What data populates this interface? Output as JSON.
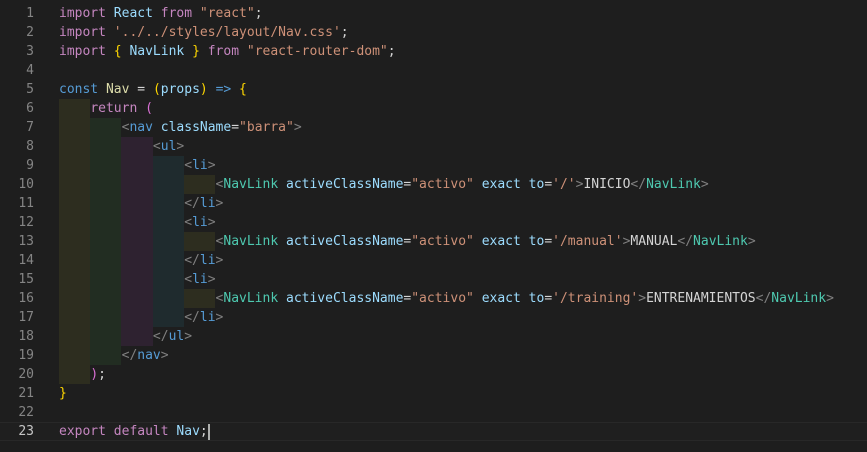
{
  "editor": {
    "lines": [
      {
        "n": "1",
        "tokens": [
          {
            "t": "import",
            "c": "#c586c0"
          },
          {
            "t": " React ",
            "c": "#9cdcfe"
          },
          {
            "t": "from",
            "c": "#c586c0"
          },
          {
            "t": " ",
            "c": "#d4d4d4"
          },
          {
            "t": "\"react\"",
            "c": "#ce9178"
          },
          {
            "t": ";",
            "c": "#d4d4d4"
          }
        ]
      },
      {
        "n": "2",
        "tokens": [
          {
            "t": "import",
            "c": "#c586c0"
          },
          {
            "t": " ",
            "c": "#d4d4d4"
          },
          {
            "t": "'../../styles/layout/Nav.css'",
            "c": "#ce9178"
          },
          {
            "t": ";",
            "c": "#d4d4d4"
          }
        ]
      },
      {
        "n": "3",
        "tokens": [
          {
            "t": "import",
            "c": "#c586c0"
          },
          {
            "t": " ",
            "c": "#d4d4d4"
          },
          {
            "t": "{",
            "c": "#ffd700"
          },
          {
            "t": " NavLink ",
            "c": "#9cdcfe"
          },
          {
            "t": "}",
            "c": "#ffd700"
          },
          {
            "t": " ",
            "c": "#d4d4d4"
          },
          {
            "t": "from",
            "c": "#c586c0"
          },
          {
            "t": " ",
            "c": "#d4d4d4"
          },
          {
            "t": "\"react-router-dom\"",
            "c": "#ce9178"
          },
          {
            "t": ";",
            "c": "#d4d4d4"
          }
        ]
      },
      {
        "n": "4",
        "tokens": []
      },
      {
        "n": "5",
        "tokens": [
          {
            "t": "const",
            "c": "#569cd6"
          },
          {
            "t": " ",
            "c": "#d4d4d4"
          },
          {
            "t": "Nav",
            "c": "#dcdcaa"
          },
          {
            "t": " = ",
            "c": "#d4d4d4"
          },
          {
            "t": "(",
            "c": "#ffd700"
          },
          {
            "t": "props",
            "c": "#9cdcfe"
          },
          {
            "t": ")",
            "c": "#ffd700"
          },
          {
            "t": " ",
            "c": "#d4d4d4"
          },
          {
            "t": "=>",
            "c": "#569cd6"
          },
          {
            "t": " ",
            "c": "#d4d4d4"
          },
          {
            "t": "{",
            "c": "#ffd700"
          }
        ]
      },
      {
        "n": "6",
        "tokens": [
          {
            "t": "    ",
            "c": "#d4d4d4"
          },
          {
            "t": "return",
            "c": "#c586c0"
          },
          {
            "t": " ",
            "c": "#d4d4d4"
          },
          {
            "t": "(",
            "c": "#da70d6"
          }
        ]
      },
      {
        "n": "7",
        "tokens": [
          {
            "t": "        ",
            "c": "#d4d4d4"
          },
          {
            "t": "<",
            "c": "#808080"
          },
          {
            "t": "nav",
            "c": "#569cd6"
          },
          {
            "t": " ",
            "c": "#d4d4d4"
          },
          {
            "t": "className",
            "c": "#9cdcfe"
          },
          {
            "t": "=",
            "c": "#d4d4d4"
          },
          {
            "t": "\"barra\"",
            "c": "#ce9178"
          },
          {
            "t": ">",
            "c": "#808080"
          }
        ]
      },
      {
        "n": "8",
        "tokens": [
          {
            "t": "            ",
            "c": "#d4d4d4"
          },
          {
            "t": "<",
            "c": "#808080"
          },
          {
            "t": "ul",
            "c": "#569cd6"
          },
          {
            "t": ">",
            "c": "#808080"
          }
        ]
      },
      {
        "n": "9",
        "tokens": [
          {
            "t": "                ",
            "c": "#d4d4d4"
          },
          {
            "t": "<",
            "c": "#808080"
          },
          {
            "t": "li",
            "c": "#569cd6"
          },
          {
            "t": ">",
            "c": "#808080"
          }
        ]
      },
      {
        "n": "10",
        "tokens": [
          {
            "t": "                    ",
            "c": "#d4d4d4"
          },
          {
            "t": "<",
            "c": "#808080"
          },
          {
            "t": "NavLink",
            "c": "#4ec9b0"
          },
          {
            "t": " ",
            "c": "#d4d4d4"
          },
          {
            "t": "activeClassName",
            "c": "#9cdcfe"
          },
          {
            "t": "=",
            "c": "#d4d4d4"
          },
          {
            "t": "\"activo\"",
            "c": "#ce9178"
          },
          {
            "t": " ",
            "c": "#d4d4d4"
          },
          {
            "t": "exact",
            "c": "#9cdcfe"
          },
          {
            "t": " ",
            "c": "#d4d4d4"
          },
          {
            "t": "to",
            "c": "#9cdcfe"
          },
          {
            "t": "=",
            "c": "#d4d4d4"
          },
          {
            "t": "'/'",
            "c": "#ce9178"
          },
          {
            "t": ">",
            "c": "#808080"
          },
          {
            "t": "INICIO",
            "c": "#d4d4d4"
          },
          {
            "t": "</",
            "c": "#808080"
          },
          {
            "t": "NavLink",
            "c": "#4ec9b0"
          },
          {
            "t": ">",
            "c": "#808080"
          }
        ]
      },
      {
        "n": "11",
        "tokens": [
          {
            "t": "                ",
            "c": "#d4d4d4"
          },
          {
            "t": "</",
            "c": "#808080"
          },
          {
            "t": "li",
            "c": "#569cd6"
          },
          {
            "t": ">",
            "c": "#808080"
          }
        ]
      },
      {
        "n": "12",
        "tokens": [
          {
            "t": "                ",
            "c": "#d4d4d4"
          },
          {
            "t": "<",
            "c": "#808080"
          },
          {
            "t": "li",
            "c": "#569cd6"
          },
          {
            "t": ">",
            "c": "#808080"
          }
        ]
      },
      {
        "n": "13",
        "tokens": [
          {
            "t": "                    ",
            "c": "#d4d4d4"
          },
          {
            "t": "<",
            "c": "#808080"
          },
          {
            "t": "NavLink",
            "c": "#4ec9b0"
          },
          {
            "t": " ",
            "c": "#d4d4d4"
          },
          {
            "t": "activeClassName",
            "c": "#9cdcfe"
          },
          {
            "t": "=",
            "c": "#d4d4d4"
          },
          {
            "t": "\"activo\"",
            "c": "#ce9178"
          },
          {
            "t": " ",
            "c": "#d4d4d4"
          },
          {
            "t": "exact",
            "c": "#9cdcfe"
          },
          {
            "t": " ",
            "c": "#d4d4d4"
          },
          {
            "t": "to",
            "c": "#9cdcfe"
          },
          {
            "t": "=",
            "c": "#d4d4d4"
          },
          {
            "t": "'/manual'",
            "c": "#ce9178"
          },
          {
            "t": ">",
            "c": "#808080"
          },
          {
            "t": "MANUAL",
            "c": "#d4d4d4"
          },
          {
            "t": "</",
            "c": "#808080"
          },
          {
            "t": "NavLink",
            "c": "#4ec9b0"
          },
          {
            "t": ">",
            "c": "#808080"
          }
        ]
      },
      {
        "n": "14",
        "tokens": [
          {
            "t": "                ",
            "c": "#d4d4d4"
          },
          {
            "t": "</",
            "c": "#808080"
          },
          {
            "t": "li",
            "c": "#569cd6"
          },
          {
            "t": ">",
            "c": "#808080"
          }
        ]
      },
      {
        "n": "15",
        "tokens": [
          {
            "t": "                ",
            "c": "#d4d4d4"
          },
          {
            "t": "<",
            "c": "#808080"
          },
          {
            "t": "li",
            "c": "#569cd6"
          },
          {
            "t": ">",
            "c": "#808080"
          }
        ]
      },
      {
        "n": "16",
        "tokens": [
          {
            "t": "                    ",
            "c": "#d4d4d4"
          },
          {
            "t": "<",
            "c": "#808080"
          },
          {
            "t": "NavLink",
            "c": "#4ec9b0"
          },
          {
            "t": " ",
            "c": "#d4d4d4"
          },
          {
            "t": "activeClassName",
            "c": "#9cdcfe"
          },
          {
            "t": "=",
            "c": "#d4d4d4"
          },
          {
            "t": "\"activo\"",
            "c": "#ce9178"
          },
          {
            "t": " ",
            "c": "#d4d4d4"
          },
          {
            "t": "exact",
            "c": "#9cdcfe"
          },
          {
            "t": " ",
            "c": "#d4d4d4"
          },
          {
            "t": "to",
            "c": "#9cdcfe"
          },
          {
            "t": "=",
            "c": "#d4d4d4"
          },
          {
            "t": "'/training'",
            "c": "#ce9178"
          },
          {
            "t": ">",
            "c": "#808080"
          },
          {
            "t": "ENTRENAMIENTOS",
            "c": "#d4d4d4"
          },
          {
            "t": "</",
            "c": "#808080"
          },
          {
            "t": "NavLink",
            "c": "#4ec9b0"
          },
          {
            "t": ">",
            "c": "#808080"
          }
        ]
      },
      {
        "n": "17",
        "tokens": [
          {
            "t": "                ",
            "c": "#d4d4d4"
          },
          {
            "t": "</",
            "c": "#808080"
          },
          {
            "t": "li",
            "c": "#569cd6"
          },
          {
            "t": ">",
            "c": "#808080"
          }
        ]
      },
      {
        "n": "18",
        "tokens": [
          {
            "t": "            ",
            "c": "#d4d4d4"
          },
          {
            "t": "</",
            "c": "#808080"
          },
          {
            "t": "ul",
            "c": "#569cd6"
          },
          {
            "t": ">",
            "c": "#808080"
          }
        ]
      },
      {
        "n": "19",
        "tokens": [
          {
            "t": "        ",
            "c": "#d4d4d4"
          },
          {
            "t": "</",
            "c": "#808080"
          },
          {
            "t": "nav",
            "c": "#569cd6"
          },
          {
            "t": ">",
            "c": "#808080"
          }
        ]
      },
      {
        "n": "20",
        "tokens": [
          {
            "t": "    ",
            "c": "#d4d4d4"
          },
          {
            "t": ")",
            "c": "#da70d6"
          },
          {
            "t": ";",
            "c": "#d4d4d4"
          }
        ]
      },
      {
        "n": "21",
        "tokens": [
          {
            "t": "}",
            "c": "#ffd700"
          }
        ]
      },
      {
        "n": "22",
        "tokens": []
      },
      {
        "n": "23",
        "tokens": [
          {
            "t": "export",
            "c": "#c586c0"
          },
          {
            "t": " ",
            "c": "#d4d4d4"
          },
          {
            "t": "default",
            "c": "#c586c0"
          },
          {
            "t": " ",
            "c": "#d4d4d4"
          },
          {
            "t": "Nav",
            "c": "#9cdcfe"
          },
          {
            "t": ";",
            "c": "#d4d4d4"
          }
        ]
      }
    ],
    "active_line": "23",
    "colors": {
      "background": "#1e1e1e",
      "line_number": "#858585",
      "line_number_active": "#c6c6c6"
    }
  }
}
